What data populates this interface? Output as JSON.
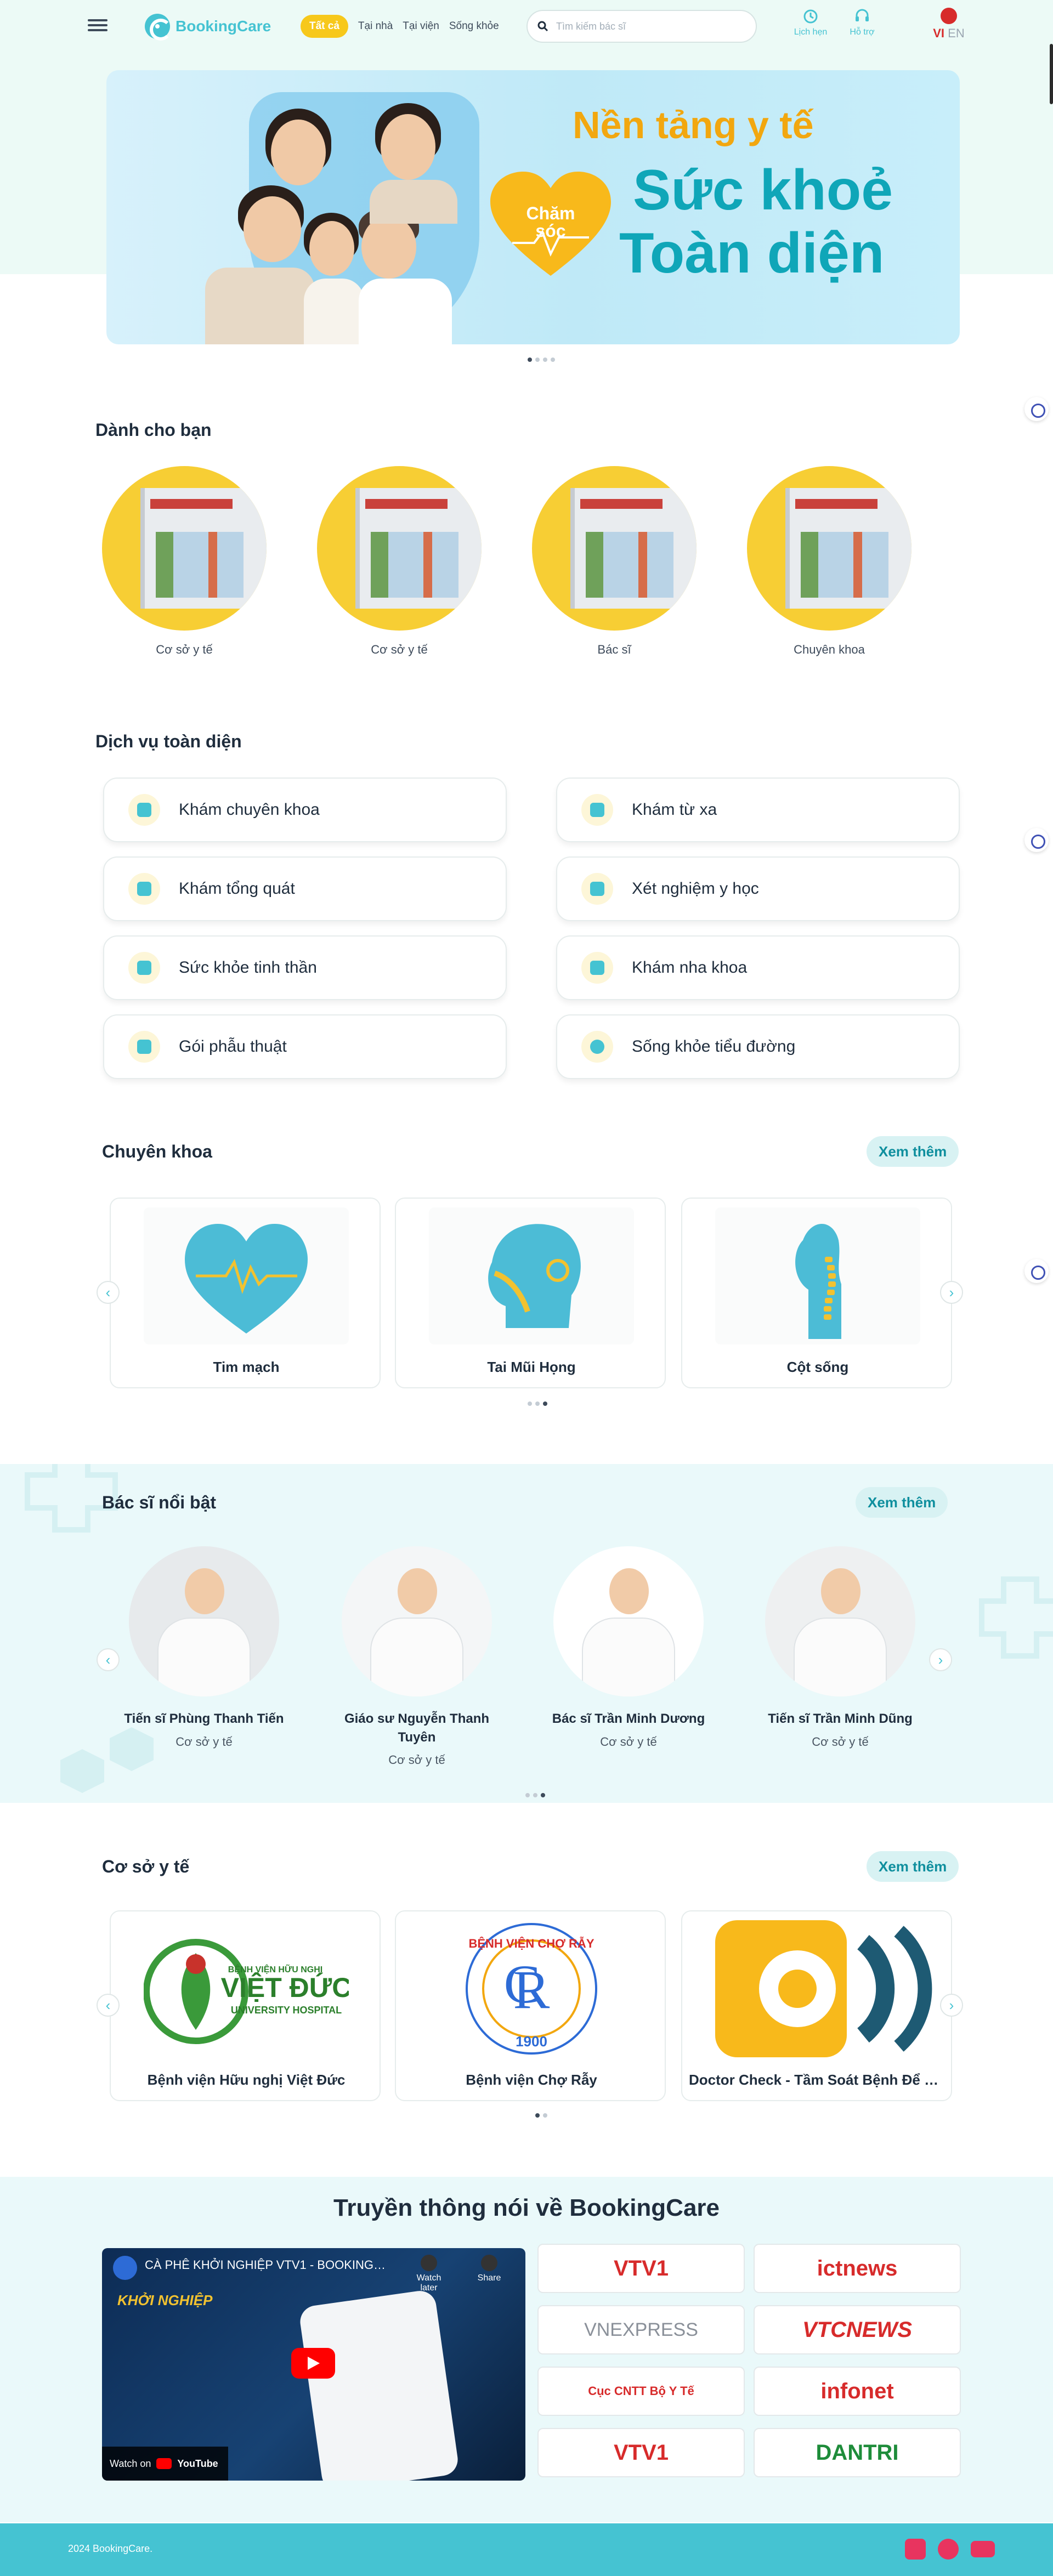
{
  "header": {
    "logo_text": "BookingCare",
    "nav": [
      "Tất cả",
      "Tại nhà",
      "Tại viện",
      "Sống khỏe"
    ],
    "search_placeholder": "Tìm kiếm bác sĩ",
    "appointments_label": "Lịch hẹn",
    "support_label": "Hỗ trợ",
    "lang_vi": "VI",
    "lang_en": "EN"
  },
  "banner": {
    "line1": "Nền tảng y tế",
    "line2": "Sức khoẻ",
    "line3": "Toàn diện",
    "badge": "Chăm sóc"
  },
  "for_you": {
    "title": "Dành cho bạn",
    "items": [
      "Cơ sở y tế",
      "Cơ sở y tế",
      "Bác sĩ",
      "Chuyên khoa"
    ]
  },
  "services": {
    "title": "Dịch vụ toàn diện",
    "items": [
      {
        "label": "Khám chuyên khoa",
        "icon": "hospital-icon"
      },
      {
        "label": "Khám từ xa",
        "icon": "phone-icon"
      },
      {
        "label": "Khám tổng quát",
        "icon": "stethoscope-icon"
      },
      {
        "label": "Xét nghiệm y học",
        "icon": "flask-icon"
      },
      {
        "label": "Sức khỏe tinh thần",
        "icon": "mind-icon"
      },
      {
        "label": "Khám nha khoa",
        "icon": "tooth-icon"
      },
      {
        "label": "Gói phẫu thuật",
        "icon": "surgery-kit-icon"
      },
      {
        "label": "Sống khỏe tiểu đường",
        "icon": "diabetes-icon"
      }
    ]
  },
  "specialties": {
    "title": "Chuyên khoa",
    "more": "Xem thêm",
    "items": [
      "Tim mạch",
      "Tai Mũi Họng",
      "Cột sống"
    ]
  },
  "doctors": {
    "title": "Bác sĩ nổi bật",
    "more": "Xem thêm",
    "items": [
      {
        "name": "Tiến sĩ Phùng Thanh Tiến",
        "sub": "Cơ sở y tế"
      },
      {
        "name": "Giáo sư Nguyễn Thanh Tuyên",
        "sub": "Cơ sở y tế"
      },
      {
        "name": "Bác sĩ Trần Minh Dương",
        "sub": "Cơ sở y tế"
      },
      {
        "name": "Tiến sĩ Trần Minh Dũng",
        "sub": "Cơ sở y tế"
      }
    ]
  },
  "facilities": {
    "title": "Cơ sở y tế",
    "more": "Xem thêm",
    "items": [
      "Bệnh viện Hữu nghị Việt Đức",
      "Bệnh viện Chợ Rẫy",
      "Doctor Check - Tầm Soát Bệnh Để Sống Thọ Hơn"
    ],
    "logo_texts": {
      "viet_duc_top": "BỆNH VIỆN HỮU NGHỊ",
      "viet_duc_main": "VIỆT ĐỨC",
      "viet_duc_sub": "UNIVERSITY HOSPITAL",
      "cho_ray_ring": "BỆNH VIỆN CHỢ RẪY",
      "cho_ray_year": "1900"
    }
  },
  "media": {
    "title": "Truyền thông nói về BookingCare",
    "video_title": "CÀ PHÊ KHỞI NGHIỆP VTV1 - BOOKINGCARE -...",
    "watch_later": "Watch later",
    "share": "Share",
    "watch_on": "Watch on",
    "youtube": "YouTube",
    "video_overlay": "KHỞI NGHIỆP",
    "outlets": [
      "VTV1",
      "ictnews",
      "VNEXPRESS",
      "VTCNEWS",
      "Cục CNTT Bộ Y Tế",
      "infonet",
      "VTV1",
      "DANTRI"
    ]
  },
  "footer": {
    "copyright": "2024 BookingCare."
  },
  "colors": {
    "brand": "#45c3d2",
    "accent": "#f7c81b",
    "footer": "#45c3d2"
  }
}
